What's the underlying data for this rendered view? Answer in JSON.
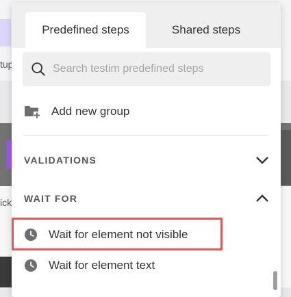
{
  "background": {
    "left_text_top": "tup",
    "left_text_mid": "ick"
  },
  "tabs": [
    {
      "label": "Predefined steps",
      "active": true
    },
    {
      "label": "Shared steps",
      "active": false
    }
  ],
  "search": {
    "placeholder": "Search testim predefined steps",
    "value": ""
  },
  "add_group": {
    "label": "Add new group",
    "icon": "folder-add-icon"
  },
  "sections": [
    {
      "label": "VALIDATIONS",
      "expanded": false,
      "icon": "chevron-down-icon"
    },
    {
      "label": "WAIT FOR",
      "expanded": true,
      "icon": "chevron-up-icon"
    }
  ],
  "steps": [
    {
      "label": "Wait for element not visible",
      "icon": "clock-icon",
      "highlighted": true
    },
    {
      "label": "Wait for element text",
      "icon": "clock-icon",
      "highlighted": false
    }
  ],
  "colors": {
    "highlight": "#e0565a",
    "icon": "#6d6d72",
    "text": "#333333"
  }
}
